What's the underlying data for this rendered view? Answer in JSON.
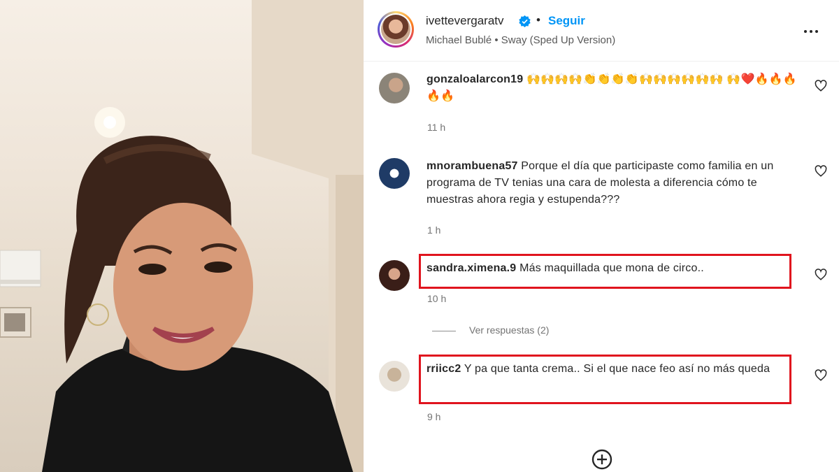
{
  "post": {
    "username": "ivettevergaratv",
    "separator": "•",
    "follow_label": "Seguir",
    "song": "Michael Bublé • Sway (Sped Up Version)",
    "verified_icon": "verified-badge-icon",
    "more_icon": "more-options-icon"
  },
  "comments": [
    {
      "username": "gonzaloalarcon19",
      "text": "🙌🙌🙌🙌👏👏👏👏🙌🙌🙌🙌🙌🙌 🙌❤️🔥🔥🔥🔥🔥",
      "time": "11 h"
    },
    {
      "username": "mnorambuena57",
      "text": "Porque el día que participaste como familia en un programa de TV tenias una cara de molesta a diferencia cómo te muestras ahora regia y estupenda???",
      "time": "1 h"
    },
    {
      "username": "sandra.ximena.9",
      "text": "Más maquillada que mona de circo..",
      "time": "10 h"
    },
    {
      "username": "rriicc2",
      "text": "Y pa que tanta crema.. Si el que nace feo así no más queda",
      "time": "9 h"
    }
  ],
  "replies_label": "Ver respuestas (2)",
  "colors": {
    "follow": "#0095f6",
    "highlight_box": "#e0141e",
    "muted_text": "#737373"
  },
  "icons": {
    "like": "heart-outline-icon",
    "add_comment": "plus-circle-icon"
  }
}
